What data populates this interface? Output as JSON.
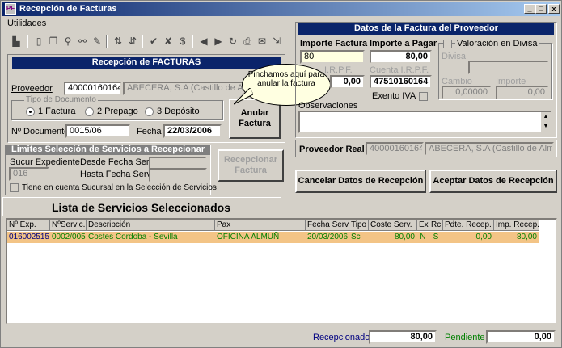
{
  "window": {
    "title": "Recepción de Facturas",
    "minimize": "_",
    "maximize": "□",
    "close": "x"
  },
  "menu": {
    "utilidades": "Utilidades"
  },
  "recepcion": {
    "header": "Recepción de FACTURAS",
    "proveedor_label": "Proveedor",
    "proveedor_code": "40000160164",
    "proveedor_name": "ABECERA, S.A (Castillo de Alm",
    "tipo_doc_legend": "Tipo de Documento",
    "radio_factura": "1 Factura",
    "radio_prepago": "2 Prepago",
    "radio_deposito": "3 Depósito",
    "anular_button": "Anular Factura",
    "n_documento_label": "Nº Documento",
    "n_documento": "0015/06",
    "fecha_label": "Fecha",
    "fecha": "22/03/2006"
  },
  "callout": {
    "text": "Pinchamos aquí para anular la factura"
  },
  "limites": {
    "header": "Limites Selección de Servicios a Recepcionar",
    "sucur_label": "Sucur Expediente",
    "sucur_value": "016",
    "desde_label": "Desde Fecha Serv.",
    "hasta_label": "Hasta Fecha Serv.",
    "tiene_label": "Tiene en cuenta Sucursal en la Selección de Servicios",
    "recepcionar_button": "Recepcionar Factura"
  },
  "datos_proveedor": {
    "header": "Datos de la Factura del Proveedor",
    "importe_factura_label": "Importe Factura",
    "importe_factura": "80",
    "importe_pagar_label": "Importe a Pagar",
    "importe_pagar": "80,00",
    "irpf_label": "I.R.P.F.",
    "irpf_value": "0,00",
    "cuenta_irpf_label": "Cuenta I.R.P.F.",
    "cuenta_irpf": "47510160164",
    "exento_iva_label": "Exento IVA",
    "valoracion_label": "Valoración en Divisa",
    "divisa_label": "Divisa",
    "cambio_label": "Cambio",
    "cambio_value": "0,00000",
    "importe_label": "Importe",
    "importe_value": "0,00",
    "observaciones_label": "Observaciones",
    "proveedor_real_label": "Proveedor Real",
    "proveedor_real_code": "40000160164",
    "proveedor_real_name": "ABECERA, S.A (Castillo de Alm",
    "cancelar_button": "Cancelar Datos de Recepción",
    "aceptar_button": "Aceptar Datos de Recepción"
  },
  "lista": {
    "tab_title": "Lista de Servicios Seleccionados",
    "columns": [
      "Nº Exp.",
      "NºServic.",
      "Descripción",
      "Pax",
      "Fecha Serv",
      "Tipo",
      "Coste Serv.",
      "Ex",
      "Rc",
      "Pdte. Recep.",
      "Imp. Recep."
    ],
    "rows": [
      [
        "016002515",
        "0002/005",
        "Costes Cordoba - Sevilla",
        "OFICINA ALMUÑ",
        "20/03/2006",
        "Sc",
        "80,00",
        "N",
        "S",
        "0,00",
        "80,00"
      ]
    ]
  },
  "footer": {
    "recepcionado_label": "Recepcionado",
    "recepcionado_value": "80,00",
    "pendiente_label": "Pendiente",
    "pendiente_value": "0,00"
  }
}
